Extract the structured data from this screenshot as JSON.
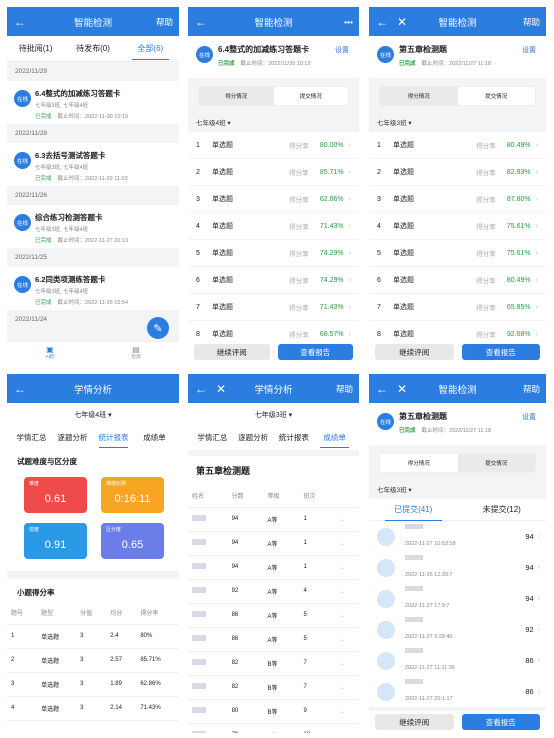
{
  "p1": {
    "title": "智能检测",
    "help": "帮助",
    "tabs": [
      "待批阅(1)",
      "待发布(0)",
      "全部(6)"
    ],
    "groups": [
      {
        "date": "2022/11/29",
        "items": [
          {
            "badge": "在线",
            "title": "6.4整式的加减练习答题卡",
            "classes": "七年级3班, 七年级4班",
            "status": "已完成",
            "deadline": "截止时间：2022-11-30 10:19"
          }
        ]
      },
      {
        "date": "2022/11/28",
        "items": [
          {
            "badge": "在线",
            "title": "6.3去括号测试答题卡",
            "classes": "七年级3班, 七年级4班",
            "status": "已完成",
            "deadline": "截止时间：2022-11-29 11:03"
          }
        ]
      },
      {
        "date": "2022/11/26",
        "items": [
          {
            "badge": "在线",
            "title": "综合练习检测答题卡",
            "classes": "七年级3班, 七年级4班",
            "status": "已完成",
            "deadline": "截止时间：2022-11-27 20:13"
          }
        ]
      },
      {
        "date": "2022/11/25",
        "items": [
          {
            "badge": "在线",
            "title": "6.2同类项测练答题卡",
            "classes": "七年级3班, 七年级4班",
            "status": "已完成",
            "deadline": "截止时间：2022-11-26 15:54"
          }
        ]
      },
      {
        "date": "2022/11/24",
        "items": []
      }
    ],
    "nav": [
      "AI检",
      "检测"
    ]
  },
  "p2": {
    "title": "智能检测",
    "badge": "在线",
    "name": "6.4整式的加减练习答题卡",
    "settings": "设置",
    "status": "已完成",
    "deadline": "截止时间：2022/11/30 10:19",
    "seg": [
      "得分情况",
      "提交情况"
    ],
    "cls": "七年级4班 ▾",
    "rate_label": "得分率",
    "rows": [
      [
        "1",
        "单选题",
        "80.00%"
      ],
      [
        "2",
        "单选题",
        "85.71%"
      ],
      [
        "3",
        "单选题",
        "62.86%"
      ],
      [
        "4",
        "单选题",
        "71.43%"
      ],
      [
        "5",
        "单选题",
        "74.29%"
      ],
      [
        "6",
        "单选题",
        "74.29%"
      ],
      [
        "7",
        "单选题",
        "71.43%"
      ],
      [
        "8",
        "单选题",
        "68.57%"
      ]
    ],
    "btn1": "继续评阅",
    "btn2": "查看报告"
  },
  "p3": {
    "title": "智能检测",
    "help": "帮助",
    "badge": "在线",
    "name": "第五章检测题",
    "settings": "设置",
    "status": "已完成",
    "deadline": "截止时间：2022/11/27 11:18",
    "seg": [
      "得分情况",
      "提交情况"
    ],
    "cls": "七年级3班 ▾",
    "rate_label": "得分率",
    "rows": [
      [
        "1",
        "单选题",
        "80.49%"
      ],
      [
        "2",
        "单选题",
        "82.93%"
      ],
      [
        "3",
        "单选题",
        "87.80%"
      ],
      [
        "4",
        "单选题",
        "75.61%"
      ],
      [
        "5",
        "单选题",
        "75.61%"
      ],
      [
        "6",
        "单选题",
        "80.49%"
      ],
      [
        "7",
        "单选题",
        "65.85%"
      ],
      [
        "8",
        "单选题",
        "92.68%"
      ]
    ],
    "btn1": "继续评阅",
    "btn2": "查看报告"
  },
  "p4": {
    "title": "学情分析",
    "cls": "七年级4班 ▾",
    "tabs": [
      "学情汇总",
      "逐题分析",
      "统计报表",
      "成绩单"
    ],
    "sec1": "试题难度与区分度",
    "stats": [
      {
        "label": "难度",
        "value": "0.61",
        "color": "#ef4b4b"
      },
      {
        "label": "难度比例",
        "value": "0:16:11",
        "color": "#f6a623"
      },
      {
        "label": "信度",
        "value": "0.91",
        "color": "#2b9ae6"
      },
      {
        "label": "区分度",
        "value": "0.65",
        "color": "#6a7de8"
      }
    ],
    "sec2": "小题得分率",
    "cols": [
      "题号",
      "题型",
      "分值",
      "均分",
      "得分率"
    ],
    "rows": [
      [
        "1",
        "单选题",
        "3",
        "2.4",
        "80%"
      ],
      [
        "2",
        "单选题",
        "3",
        "2.57",
        "85.71%"
      ],
      [
        "3",
        "单选题",
        "3",
        "1.89",
        "62.86%"
      ],
      [
        "4",
        "单选题",
        "3",
        "2.14",
        "71.43%"
      ]
    ]
  },
  "p5": {
    "title": "学情分析",
    "help": "帮助",
    "cls": "七年级3班 ▾",
    "tabs": [
      "学情汇总",
      "逐题分析",
      "统计报表",
      "成绩单"
    ],
    "exam": "第五章检测题",
    "cols": [
      "姓名",
      "分数",
      "等级",
      "班次"
    ],
    "rows": [
      [
        "94",
        "A等",
        "1"
      ],
      [
        "94",
        "A等",
        "1"
      ],
      [
        "94",
        "A等",
        "1"
      ],
      [
        "92",
        "A等",
        "4"
      ],
      [
        "86",
        "A等",
        "5"
      ],
      [
        "86",
        "A等",
        "5"
      ],
      [
        "82",
        "B等",
        "7"
      ],
      [
        "82",
        "B等",
        "7"
      ],
      [
        "80",
        "B等",
        "9"
      ],
      [
        "79",
        "B等",
        "10"
      ]
    ]
  },
  "p6": {
    "title": "智能检测",
    "help": "帮助",
    "badge": "在线",
    "name": "第五章检测题",
    "settings": "设置",
    "status": "已完成",
    "deadline": "截止时间：2022/11/27 11:18",
    "seg": [
      "得分情况",
      "提交情况"
    ],
    "cls": "七年级3班 ▾",
    "tabs": [
      "已提交(41)",
      "未提交(12)"
    ],
    "rows": [
      [
        "2022-11-27 10:53:58",
        "94"
      ],
      [
        "2022-11-26 12:39:7",
        "94"
      ],
      [
        "2022-11-27 17:9:7",
        "94"
      ],
      [
        "2022-11-27 9:28:40",
        "92"
      ],
      [
        "2022-11-27 11:11:36",
        "86"
      ],
      [
        "2022-11-27 20:1:17",
        "86"
      ]
    ],
    "btn1": "继续评阅",
    "btn2": "查看报告"
  }
}
